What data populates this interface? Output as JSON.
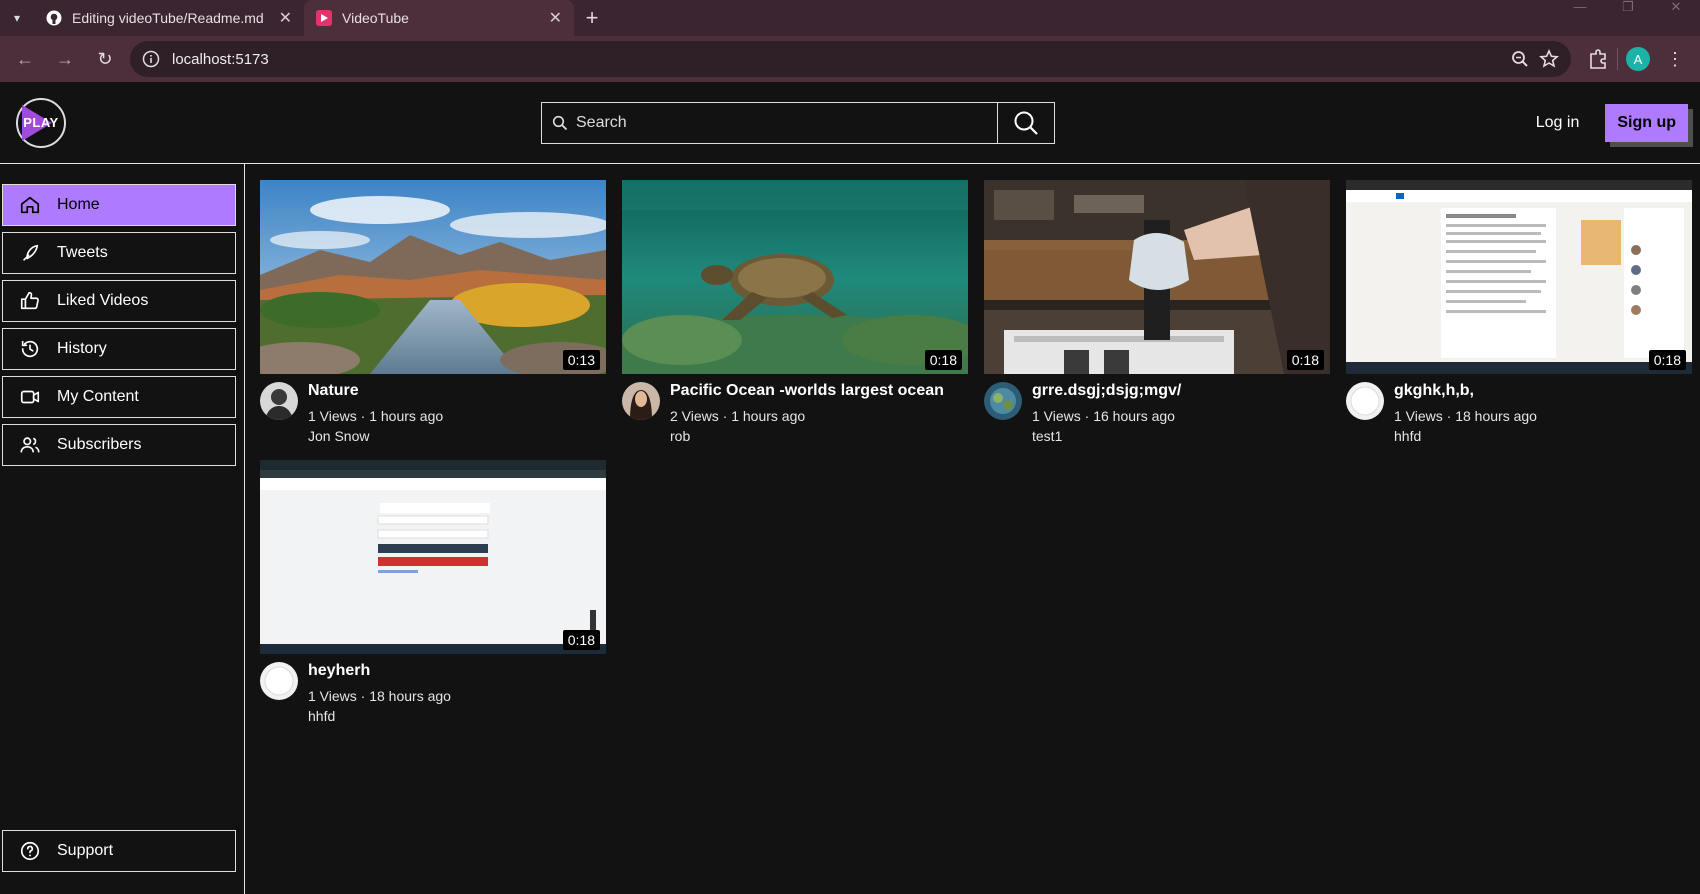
{
  "browser": {
    "tabs": [
      {
        "title": "Editing videoTube/Readme.md",
        "icon": "github-icon",
        "active": false
      },
      {
        "title": "VideoTube",
        "icon": "videotube-favicon-icon",
        "active": true
      }
    ],
    "url": "localhost:5173",
    "profile_initial": "A"
  },
  "header": {
    "logo_text": "PLAY",
    "search_placeholder": "Search",
    "login_label": "Log in",
    "signup_label": "Sign up"
  },
  "sidebar": {
    "items": [
      {
        "label": "Home",
        "icon": "home-icon",
        "active": true
      },
      {
        "label": "Tweets",
        "icon": "tweets-icon",
        "active": false
      },
      {
        "label": "Liked Videos",
        "icon": "thumbs-up-icon",
        "active": false
      },
      {
        "label": "History",
        "icon": "history-icon",
        "active": false
      },
      {
        "label": "My Content",
        "icon": "video-camera-icon",
        "active": false
      },
      {
        "label": "Subscribers",
        "icon": "users-icon",
        "active": false
      }
    ],
    "support_label": "Support"
  },
  "videos": [
    {
      "title": "Nature",
      "stats": "1 Views · 1 hours ago",
      "channel": "Jon Snow",
      "duration": "0:13"
    },
    {
      "title": "Pacific Ocean -worlds largest ocean",
      "stats": "2 Views · 1 hours ago",
      "channel": "rob",
      "duration": "0:18"
    },
    {
      "title": "grre.dsgj;dsjg;mgv/",
      "stats": "1 Views · 16 hours ago",
      "channel": "test1",
      "duration": "0:18"
    },
    {
      "title": "gkghk,h,b,",
      "stats": "1 Views · 18 hours ago",
      "channel": "hhfd",
      "duration": "0:18"
    },
    {
      "title": "heyherh",
      "stats": "1 Views · 18 hours ago",
      "channel": "hhfd",
      "duration": "0:18"
    }
  ],
  "colors": {
    "accent": "#ae7aff",
    "background": "#121212",
    "chrome": "#4d2f3c"
  }
}
